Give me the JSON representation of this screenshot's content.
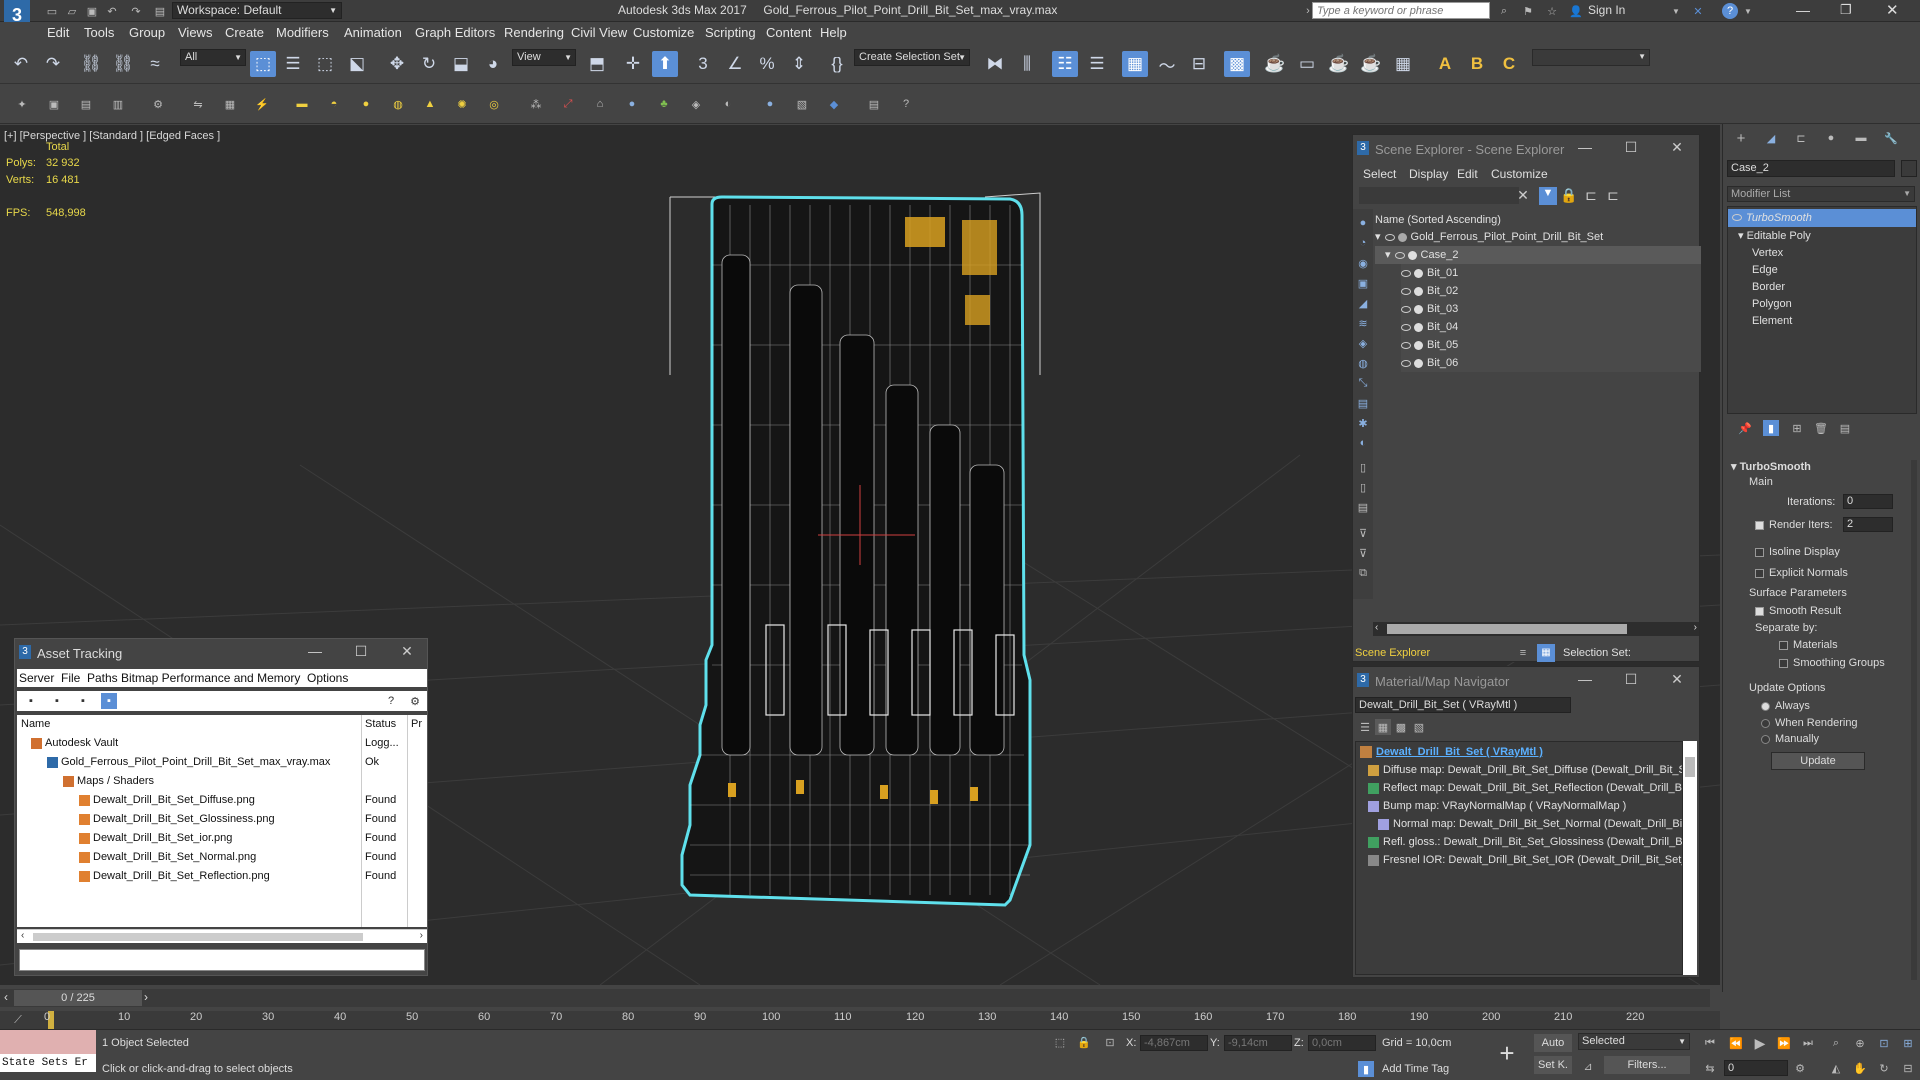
{
  "app": {
    "title": "Autodesk 3ds Max 2017",
    "file": "Gold_Ferrous_Pilot_Point_Drill_Bit_Set_max_vray.max",
    "workspace": "Workspace: Default",
    "search_placeholder": "Type a keyword or phrase",
    "sign_in": "Sign In"
  },
  "menu": [
    "Edit",
    "Tools",
    "Group",
    "Views",
    "Create",
    "Modifiers",
    "Animation",
    "Graph Editors",
    "Rendering",
    "Civil View",
    "Customize",
    "Scripting",
    "Content",
    "Help"
  ],
  "toolbar": {
    "filter": "All",
    "ref_coord": "View",
    "selection_set": "Create Selection Set"
  },
  "viewport": {
    "label": "[+] [Perspective ] [Standard ] [Edged Faces ]",
    "stats_header": "Total",
    "polys_label": "Polys:",
    "polys": "32 932",
    "verts_label": "Verts:",
    "verts": "16 481",
    "fps_label": "FPS:",
    "fps": "548,998"
  },
  "scene_explorer": {
    "title": "Scene Explorer - Scene Explorer",
    "menu": [
      "Select",
      "Display",
      "Edit",
      "Customize"
    ],
    "column": "Name (Sorted Ascending)",
    "root": "Gold_Ferrous_Pilot_Point_Drill_Bit_Set",
    "parent": "Case_2",
    "children": [
      "Bit_01",
      "Bit_02",
      "Bit_03",
      "Bit_04",
      "Bit_05",
      "Bit_06"
    ],
    "footer_name": "Scene Explorer",
    "selection_set_label": "Selection Set:"
  },
  "material_nav": {
    "title": "Material/Map Navigator",
    "current": "Dewalt_Drill_Bit_Set  ( VRayMtl )",
    "root": "Dewalt_Drill_Bit_Set  ( VRayMtl )",
    "maps": [
      "Diffuse map: Dewalt_Drill_Bit_Set_Diffuse (Dewalt_Drill_Bit_S",
      "Reflect map: Dewalt_Drill_Bit_Set_Reflection (Dewalt_Drill_Bi",
      "Bump map: VRayNormalMap  ( VRayNormalMap )",
      "Normal map: Dewalt_Drill_Bit_Set_Normal (Dewalt_Drill_Bit",
      "Refl. gloss.: Dewalt_Drill_Bit_Set_Glossiness (Dewalt_Drill_Bit",
      "Fresnel IOR: Dewalt_Drill_Bit_Set_IOR (Dewalt_Drill_Bit_Set_"
    ]
  },
  "asset_tracking": {
    "title": "Asset Tracking",
    "menu": [
      "Server",
      "File",
      "Paths",
      "Bitmap Performance and Memory",
      "Options"
    ],
    "col_name": "Name",
    "col_status": "Status",
    "col_pr": "Pr",
    "rows": [
      {
        "name": "Autodesk Vault",
        "status": "Logg..."
      },
      {
        "name": "Gold_Ferrous_Pilot_Point_Drill_Bit_Set_max_vray.max",
        "status": "Ok"
      },
      {
        "name": "Maps / Shaders",
        "status": ""
      },
      {
        "name": "Dewalt_Drill_Bit_Set_Diffuse.png",
        "status": "Found"
      },
      {
        "name": "Dewalt_Drill_Bit_Set_Glossiness.png",
        "status": "Found"
      },
      {
        "name": "Dewalt_Drill_Bit_Set_ior.png",
        "status": "Found"
      },
      {
        "name": "Dewalt_Drill_Bit_Set_Normal.png",
        "status": "Found"
      },
      {
        "name": "Dewalt_Drill_Bit_Set_Reflection.png",
        "status": "Found"
      }
    ]
  },
  "command_panel": {
    "object_name": "Case_2",
    "modifier_list": "Modifier List",
    "stack": [
      "TurboSmooth",
      "Editable Poly",
      "Vertex",
      "Edge",
      "Border",
      "Polygon",
      "Element"
    ],
    "rollout": "TurboSmooth",
    "main": "Main",
    "iterations_label": "Iterations:",
    "iterations": "0",
    "render_iters_label": "Render Iters:",
    "render_iters": "2",
    "isoline": "Isoline Display",
    "explicit": "Explicit Normals",
    "surface": "Surface Parameters",
    "smooth_result": "Smooth Result",
    "separate_by": "Separate by:",
    "materials": "Materials",
    "smoothing_groups": "Smoothing Groups",
    "update_options": "Update Options",
    "always": "Always",
    "when_rendering": "When Rendering",
    "manually": "Manually",
    "update": "Update"
  },
  "timeline": {
    "frame": "0 / 225",
    "ticks": [
      "0",
      "10",
      "20",
      "30",
      "40",
      "50",
      "60",
      "70",
      "80",
      "90",
      "100",
      "110",
      "120",
      "130",
      "140",
      "150",
      "160",
      "170",
      "180",
      "190",
      "200",
      "210",
      "220"
    ]
  },
  "status": {
    "maxscript": "State Sets Er",
    "selected": "1 Object Selected",
    "prompt": "Click or click-and-drag to select objects",
    "x_label": "X:",
    "x": "-4,867cm",
    "y_label": "Y:",
    "y": "-9,14cm",
    "z_label": "Z:",
    "z": "0,0cm",
    "grid": "Grid = 10,0cm",
    "add_time_tag": "Add Time Tag",
    "auto": "Auto",
    "set_key": "Set K.",
    "selected_dd": "Selected",
    "filters": "Filters...",
    "frame_field": "0"
  }
}
